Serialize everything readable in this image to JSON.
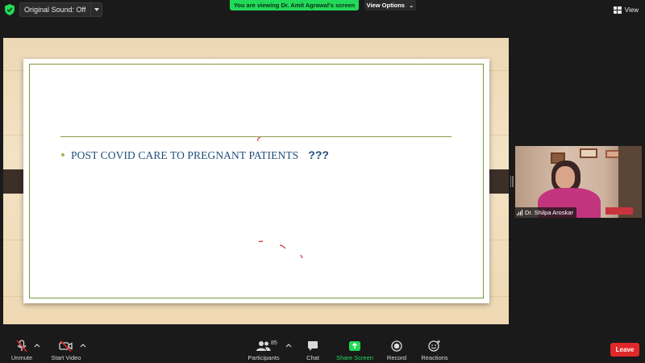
{
  "topbar": {
    "sound_label": "Original Sound: Off",
    "banner_text": "You are viewing Dr. Amit Agrawal's screen",
    "view_options_label": "View Options",
    "view_label": "View"
  },
  "slide": {
    "bullet_text": "POST COVID  CARE TO  PREGNANT PATIENTS",
    "bullet_question": "???"
  },
  "video_tile": {
    "participant_name": "Dr. Shilpa Aroskar"
  },
  "toolbar": {
    "unmute_label": "Unmute",
    "start_video_label": "Start Video",
    "participants_label": "Participants",
    "participants_count": "85",
    "chat_label": "Chat",
    "share_screen_label": "Share Screen",
    "record_label": "Record",
    "reactions_label": "Reactions",
    "leave_label": "Leave"
  },
  "colors": {
    "accent_green": "#23d959",
    "leave_red": "#e02828",
    "slide_text": "#1f4e79",
    "slide_border": "#7b9a3a"
  },
  "icons": [
    "shield-check-icon",
    "chevron-down-icon",
    "grid-view-icon",
    "muted-mic-icon",
    "video-off-icon",
    "participants-icon",
    "chat-icon",
    "share-screen-icon",
    "record-icon",
    "reactions-icon",
    "signal-icon"
  ]
}
